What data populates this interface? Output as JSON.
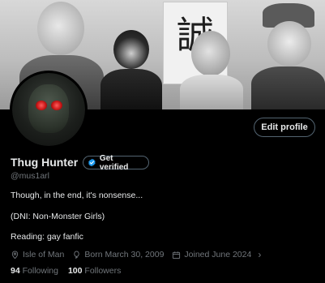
{
  "banner": {
    "kanji": "誠"
  },
  "profile": {
    "name": "Thug Hunter",
    "handle": "@mus1arl",
    "edit_button": "Edit profile",
    "verify_label": "Get verified",
    "bio": [
      "Though, in the end, it's nonsense...",
      "(DNI: Non-Monster Girls)",
      "Reading: gay fanfic"
    ],
    "location": "Isle of Man",
    "born": "Born March 30, 2009",
    "joined": "Joined June 2024",
    "following_count": "94",
    "following_label": "Following",
    "followers_count": "100",
    "followers_label": "Followers"
  },
  "colors": {
    "background": "#000000",
    "text_primary": "#e7e9ea",
    "text_secondary": "#71767b",
    "border": "#536471",
    "verified_blue": "#1d9bf0"
  },
  "icons": {
    "location": "location-pin-icon",
    "birthday": "balloon-icon",
    "calendar": "calendar-icon",
    "verified": "verified-badge-icon",
    "chevron": "chevron-right-icon"
  }
}
